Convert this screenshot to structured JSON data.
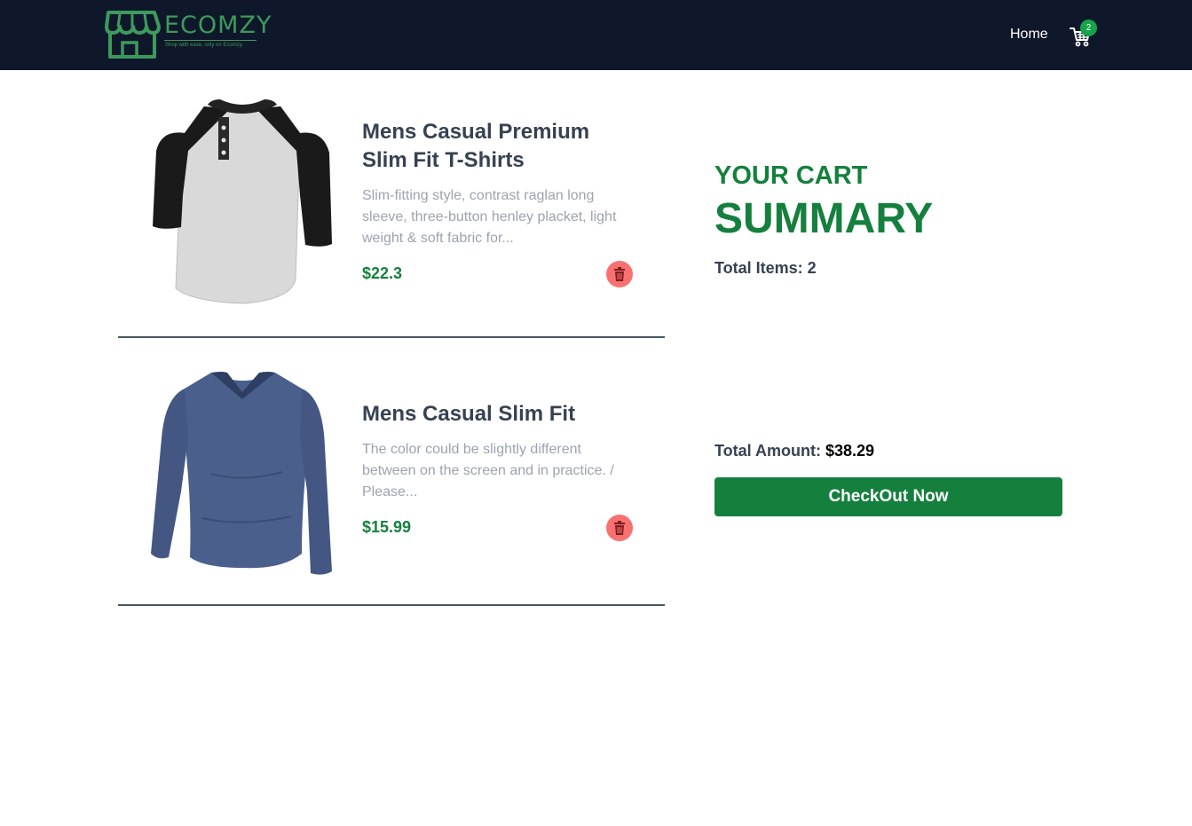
{
  "brand": {
    "name": "ECOMZY",
    "tagline": "Shop with ease, only on Ecomzy.",
    "color": "#3d9a5c"
  },
  "nav": {
    "home_label": "Home",
    "cart_icon": "shopping-cart-icon",
    "cart_count": "2",
    "background": "#0f172a"
  },
  "cart": {
    "items": [
      {
        "title": "Mens Casual Premium Slim Fit T-Shirts",
        "description": "Slim-fitting style, contrast raglan long sleeve, three-button henley placket, light weight & soft fabric for...",
        "price": "$22.3",
        "image_icon": "raglan-henley-shirt-image",
        "delete_icon": "trash-icon"
      },
      {
        "title": "Mens Casual Slim Fit",
        "description": "The color could be slightly different between on the screen and in practice. / Please...",
        "price": "$15.99",
        "image_icon": "blue-long-sleeve-shirt-image",
        "delete_icon": "trash-icon"
      }
    ]
  },
  "summary": {
    "label": "YOUR CART",
    "title": "SUMMARY",
    "total_items_label": "Total Items: 2",
    "total_amount_label": "Total Amount: ",
    "total_amount_value": "$38.29",
    "checkout_label": "CheckOut Now",
    "accent": "#15803d"
  }
}
